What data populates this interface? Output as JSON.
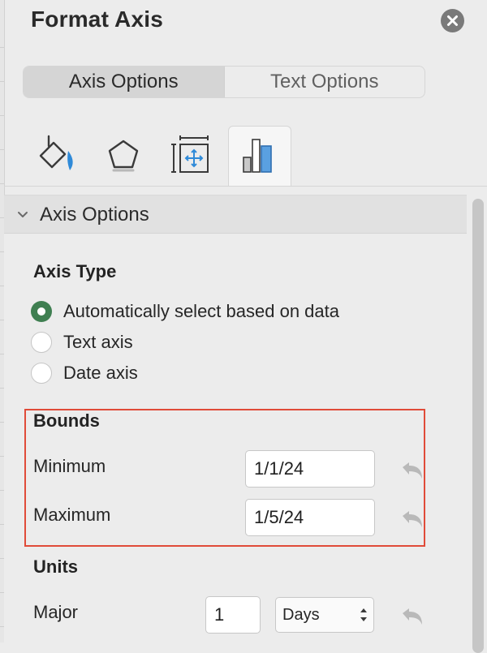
{
  "panel": {
    "title": "Format Axis",
    "close_icon": "close-circle-icon"
  },
  "tabs": {
    "options": [
      {
        "label": "Axis Options",
        "active": true
      },
      {
        "label": "Text Options",
        "active": false
      }
    ],
    "icon_tabs": [
      {
        "icon": "fill-line-icon",
        "selected": false
      },
      {
        "icon": "effects-pentagon-icon",
        "selected": false
      },
      {
        "icon": "size-properties-icon",
        "selected": false
      },
      {
        "icon": "axis-options-bar-icon",
        "selected": true
      }
    ]
  },
  "section": {
    "label": "Axis Options",
    "expanded": true
  },
  "axis_type": {
    "heading": "Axis Type",
    "options": [
      {
        "label": "Automatically select based on data",
        "checked": true
      },
      {
        "label": "Text axis",
        "checked": false
      },
      {
        "label": "Date axis",
        "checked": false
      }
    ]
  },
  "bounds": {
    "heading": "Bounds",
    "minimum_label": "Minimum",
    "minimum_value": "1/1/24",
    "maximum_label": "Maximum",
    "maximum_value": "1/5/24"
  },
  "units": {
    "heading": "Units",
    "major_label": "Major",
    "major_value": "1",
    "major_unit": "Days"
  },
  "colors": {
    "accent_green": "#3f7f51",
    "highlight_red": "#e04b39",
    "icon_blue": "#2f8ad8"
  }
}
